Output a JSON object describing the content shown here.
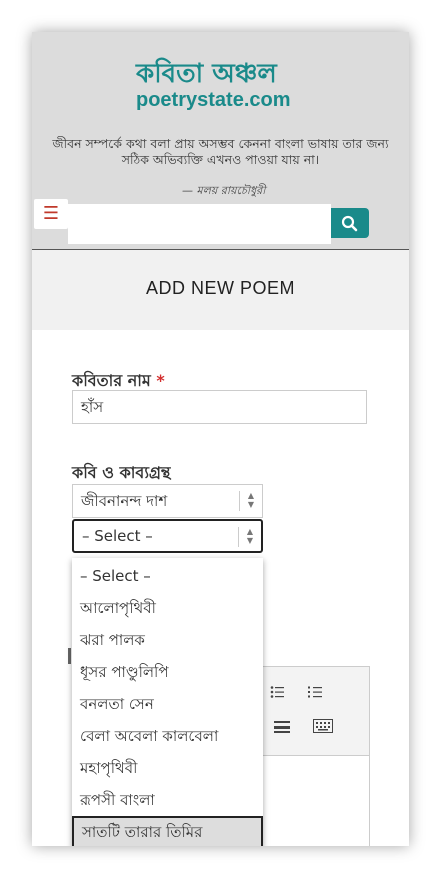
{
  "site": {
    "logo_bn": "কবিতা অঞ্চল",
    "logo_en": "poetrystate.com",
    "quote": "জীবন সম্পর্কে কথা বলা প্রায় অসম্ভব কেননা বাংলা ভাষায় তার জন্য সঠিক অভিব্যক্তি এখনও পাওয়া যায় না।",
    "quote_author": "— মলয় রায়চৌধুরী"
  },
  "nav": {
    "menu_icon": "hamburger-icon",
    "search_icon": "search-icon",
    "search_value": ""
  },
  "page": {
    "title": "ADD NEW POEM"
  },
  "form": {
    "poem_name_label": "কবিতার নাম",
    "required_mark": "*",
    "poem_name_value": "হাঁস",
    "poet_book_label": "কবি ও কাব্যগ্রন্থ",
    "poet_selected": "জীবনানন্দ দাশ",
    "book_selected": "– Select –"
  },
  "dropdown": {
    "options": [
      "– Select –",
      "আলোপৃথিবী",
      "ঝরা পালক",
      "ধূসর পাণ্ডুলিপি",
      "বনলতা সেন",
      "বেলা অবেলা কালবেলা",
      "মহাপৃথিবী",
      "রূপসী বাংলা",
      "সাতটি তারার তিমির"
    ],
    "highlighted": "সাতটি তারার তিমির"
  },
  "colors": {
    "accent": "#1a8a8a",
    "menu": "#c0392b",
    "required": "#d32f2f"
  }
}
